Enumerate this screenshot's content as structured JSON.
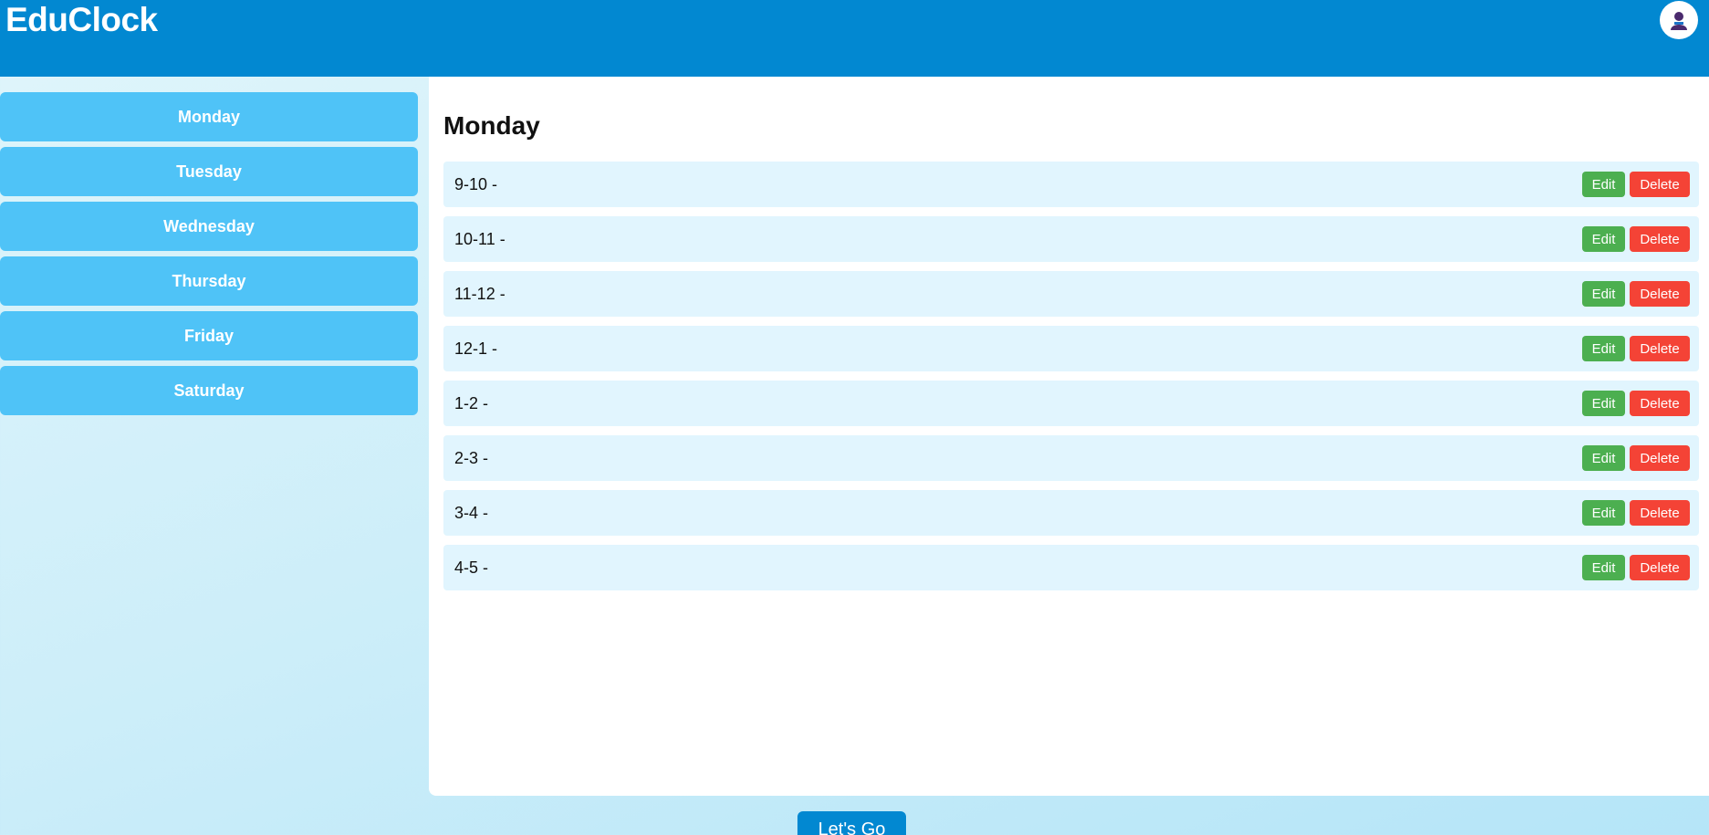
{
  "app": {
    "title": "EduClock"
  },
  "header": {
    "avatar_icon": "user-avatar-icon"
  },
  "sidebar": {
    "days": [
      {
        "label": "Monday"
      },
      {
        "label": "Tuesday"
      },
      {
        "label": "Wednesday"
      },
      {
        "label": "Thursday"
      },
      {
        "label": "Friday"
      },
      {
        "label": "Saturday"
      }
    ]
  },
  "main": {
    "title": "Monday",
    "slots": [
      {
        "time": "9-10 -",
        "edit": "Edit",
        "delete": "Delete"
      },
      {
        "time": "10-11 -",
        "edit": "Edit",
        "delete": "Delete"
      },
      {
        "time": "11-12 -",
        "edit": "Edit",
        "delete": "Delete"
      },
      {
        "time": "12-1 -",
        "edit": "Edit",
        "delete": "Delete"
      },
      {
        "time": "1-2 -",
        "edit": "Edit",
        "delete": "Delete"
      },
      {
        "time": "2-3 -",
        "edit": "Edit",
        "delete": "Delete"
      },
      {
        "time": "3-4 -",
        "edit": "Edit",
        "delete": "Delete"
      },
      {
        "time": "4-5 -",
        "edit": "Edit",
        "delete": "Delete"
      }
    ]
  },
  "footer": {
    "go_label": "Let's Go"
  },
  "colors": {
    "header": "#0288d1",
    "day_button": "#4fc3f7",
    "slot_row": "#e1f5fe",
    "edit": "#4caf50",
    "delete": "#f44336"
  }
}
